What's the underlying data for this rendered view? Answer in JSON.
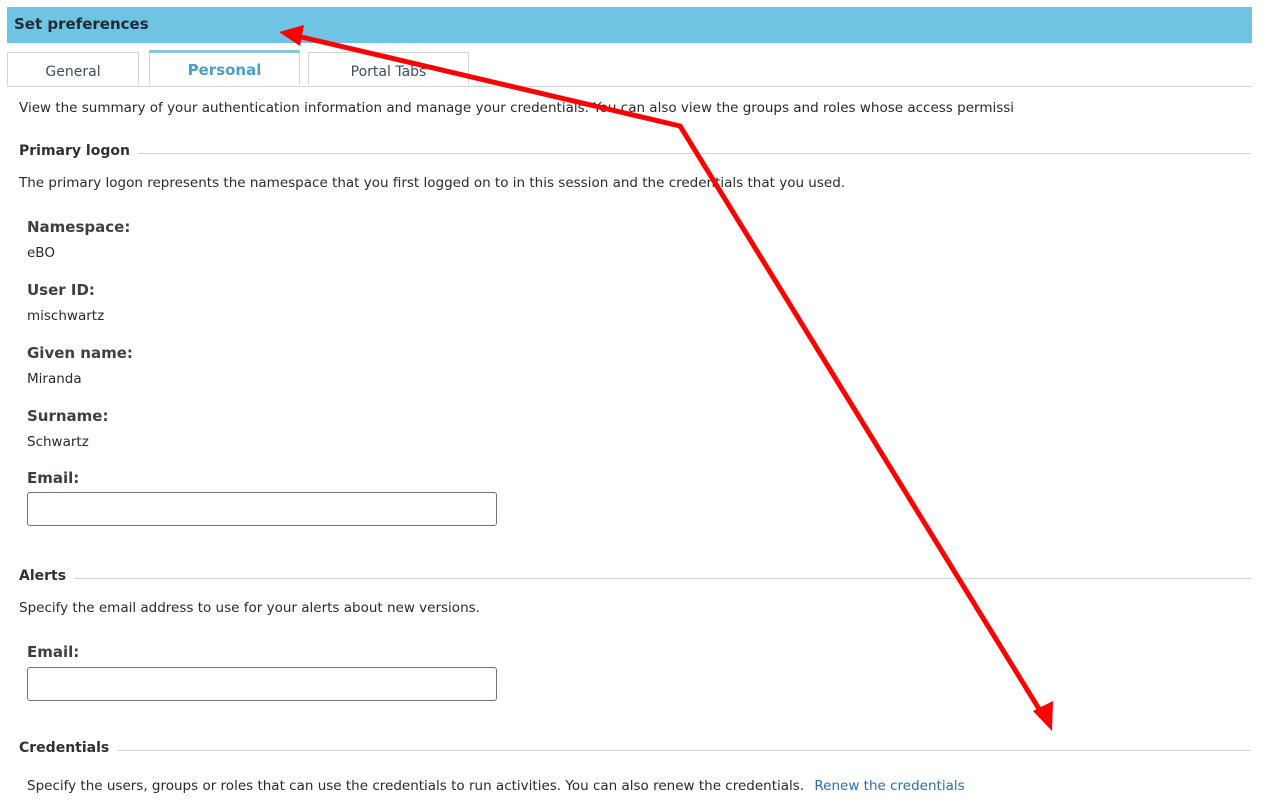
{
  "window": {
    "title": "Set preferences"
  },
  "tabs": [
    {
      "label": "General",
      "active": false
    },
    {
      "label": "Personal",
      "active": true
    },
    {
      "label": "Portal Tabs",
      "active": false
    }
  ],
  "intro": "View the summary of your authentication information and manage your credentials. You can also view the groups and roles whose access permissi",
  "primary_logon": {
    "heading": "Primary logon",
    "description": "The primary logon represents the namespace that you first logged on to in this session and the credentials that you used.",
    "namespace_label": "Namespace:",
    "namespace_value": "eBO",
    "user_id_label": "User ID:",
    "user_id_value": "mischwartz",
    "given_name_label": "Given name:",
    "given_name_value": "Miranda",
    "surname_label": "Surname:",
    "surname_value": "Schwartz",
    "email_label": "Email:",
    "email_value": ""
  },
  "alerts": {
    "heading": "Alerts",
    "description": "Specify the email address to use for your alerts about new versions.",
    "email_label": "Email:",
    "email_value": ""
  },
  "credentials": {
    "heading": "Credentials",
    "description": "Specify the users, groups or roles that can use the credentials to run activities.  You can also renew the credentials.",
    "renew_link": "Renew the credentials"
  },
  "colors": {
    "titlebar": "#6fc3e3",
    "active_tab_text": "#4b9fc9",
    "link": "#2a6fb0",
    "annotation_arrow": "#ff0000"
  },
  "annotations": {
    "arrow_icon": "red-double-arrow-icon"
  }
}
